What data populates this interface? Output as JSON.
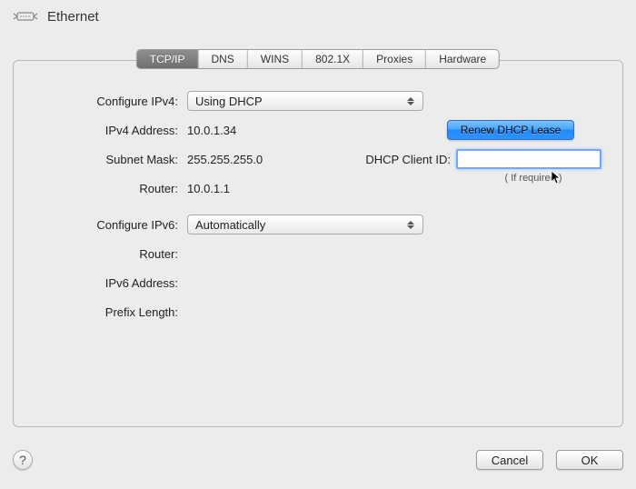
{
  "title": "Ethernet",
  "tabs": [
    "TCP/IP",
    "DNS",
    "WINS",
    "802.1X",
    "Proxies",
    "Hardware"
  ],
  "selected_tab_index": 0,
  "ipv4": {
    "configure_label": "Configure IPv4:",
    "configure_value": "Using DHCP",
    "address_label": "IPv4 Address:",
    "address_value": "10.0.1.34",
    "subnet_label": "Subnet Mask:",
    "subnet_value": "255.255.255.0",
    "router_label": "Router:",
    "router_value": "10.0.1.1"
  },
  "dhcp": {
    "renew_button": "Renew DHCP Lease",
    "client_id_label": "DHCP Client ID:",
    "client_id_value": "",
    "hint": "( If required )"
  },
  "ipv6": {
    "configure_label": "Configure IPv6:",
    "configure_value": "Automatically",
    "router_label": "Router:",
    "router_value": "",
    "address_label": "IPv6 Address:",
    "address_value": "",
    "prefix_label": "Prefix Length:",
    "prefix_value": ""
  },
  "footer": {
    "help": "?",
    "cancel": "Cancel",
    "ok": "OK"
  }
}
